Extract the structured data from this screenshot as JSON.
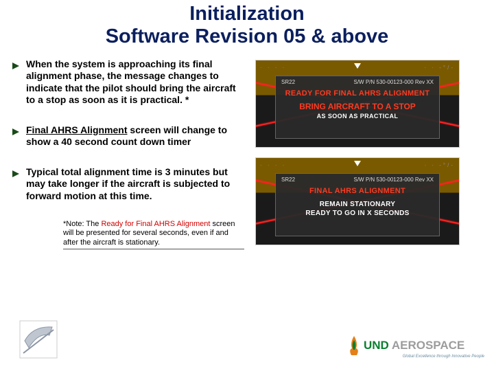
{
  "title_line1": "Initialization",
  "title_line2": "Software Revision 05 & above",
  "bullets": [
    "When the system is approaching its final alignment phase, the message changes to indicate that the pilot should bring the aircraft to a stop as soon as it is practical. *",
    "__UL__Final AHRS Alignment__/UL__ screen will change to show a 40 second count down timer",
    "Typical total alignment time is 3 minutes but may take longer if the aircraft is subjected to forward motion at this time."
  ],
  "note_prefix": "*Note: The ",
  "note_red": "Ready for Final AHRS Alignment",
  "note_suffix": " screen will be presented for several seconds, even if and after the aircraft is stationary.",
  "screen1": {
    "hdr_left": "SR22",
    "hdr_right": "S/W P/N 530-00123-000 Rev XX",
    "line1": "READY FOR FINAL AHRS ALIGNMENT",
    "line2": "BRING AIRCRAFT TO A STOP",
    "line3": "AS SOON AS PRACTICAL"
  },
  "screen2": {
    "hdr_left": "SR22",
    "hdr_right": "S/W P/N 530-00123-000 Rev XX",
    "line1": "FINAL AHRS ALIGNMENT",
    "line2": "REMAIN STATIONARY",
    "line3": "READY TO GO IN X SECONDS"
  },
  "logo": {
    "und": "UND",
    "aero": "AEROSPACE",
    "tagline": "Global Excellence through Innovative People"
  }
}
